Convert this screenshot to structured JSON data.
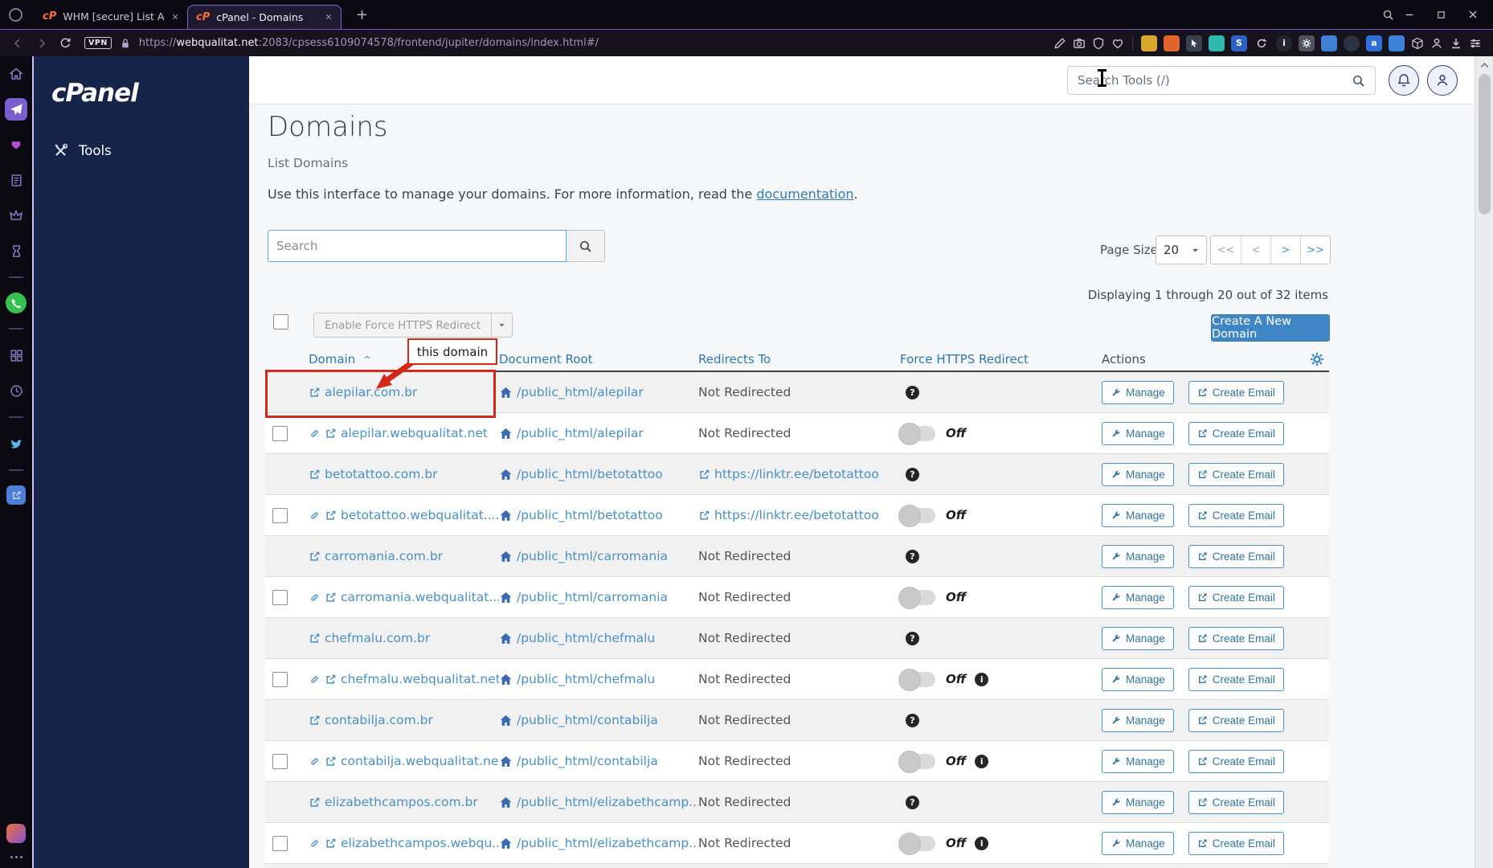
{
  "browser": {
    "tabs": [
      {
        "title": "WHM [secure] List Account"
      },
      {
        "title": "cPanel - Domains"
      }
    ],
    "new_tab_label": "+",
    "vpn_badge": "VPN",
    "url": {
      "scheme": "https://",
      "host": "webqualitat.net",
      "rest": ":2083/cpsess6109074578/frontend/jupiter/domains/index.html#/"
    }
  },
  "glyphs": {
    "question": "?",
    "info": "i",
    "stylus": "S",
    "translate": "a"
  },
  "cpanel": {
    "logo": "cPanel",
    "sidebar": {
      "tools_label": "Tools"
    },
    "header": {
      "search_placeholder": "Search Tools (/)"
    },
    "page": {
      "title": "Domains",
      "subtitle": "List Domains",
      "desc_prefix": "Use this interface to manage your domains. For more information, read the ",
      "desc_link": "documentation",
      "desc_suffix": ".",
      "search_placeholder": "Search",
      "page_size_label": "Page Size",
      "page_size_value": "20",
      "pager": {
        "first": "<<",
        "prev": "<",
        "next": ">",
        "last": ">>"
      },
      "displaying": "Displaying 1 through 20 out of 32 items",
      "bulk_button": "Enable Force HTTPS Redirect",
      "create_button": "Create A New Domain",
      "annotation_label": "this domain"
    },
    "table": {
      "headers": {
        "domain": "Domain",
        "doc_root": "Document Root",
        "redirects": "Redirects To",
        "force_https": "Force HTTPS Redirect",
        "actions": "Actions"
      },
      "sort_caret": "^",
      "off_label": "Off",
      "manage_label": "Manage",
      "create_email_label": "Create Email",
      "rows": [
        {
          "domain": "alepilar.com.br",
          "doc_root": "/public_html/alepilar",
          "redirect": "Not Redirected"
        },
        {
          "domain": "alepilar.webqualitat.net",
          "doc_root": "/public_html/alepilar",
          "redirect": "Not Redirected"
        },
        {
          "domain": "betotattoo.com.br",
          "doc_root": "/public_html/betotattoo",
          "redirect": "https://linktr.ee/betotattoo"
        },
        {
          "domain": "betotattoo.webqualitat....",
          "doc_root": "/public_html/betotattoo",
          "redirect": "https://linktr.ee/betotattoo"
        },
        {
          "domain": "carromania.com.br",
          "doc_root": "/public_html/carromania",
          "redirect": "Not Redirected"
        },
        {
          "domain": "carromania.webqualitat....",
          "doc_root": "/public_html/carromania",
          "redirect": "Not Redirected"
        },
        {
          "domain": "chefmalu.com.br",
          "doc_root": "/public_html/chefmalu",
          "redirect": "Not Redirected"
        },
        {
          "domain": "chefmalu.webqualitat.net",
          "doc_root": "/public_html/chefmalu",
          "redirect": "Not Redirected"
        },
        {
          "domain": "contabilja.com.br",
          "doc_root": "/public_html/contabilja",
          "redirect": "Not Redirected"
        },
        {
          "domain": "contabilja.webqualitat.net",
          "doc_root": "/public_html/contabilja",
          "redirect": "Not Redirected"
        },
        {
          "domain": "elizabethcampos.com.br",
          "doc_root": "/public_html/elizabethcamp...",
          "redirect": "Not Redirected"
        },
        {
          "domain": "elizabethcampos.webqu...",
          "doc_root": "/public_html/elizabethcamp...",
          "redirect": "Not Redirected"
        }
      ]
    }
  }
}
